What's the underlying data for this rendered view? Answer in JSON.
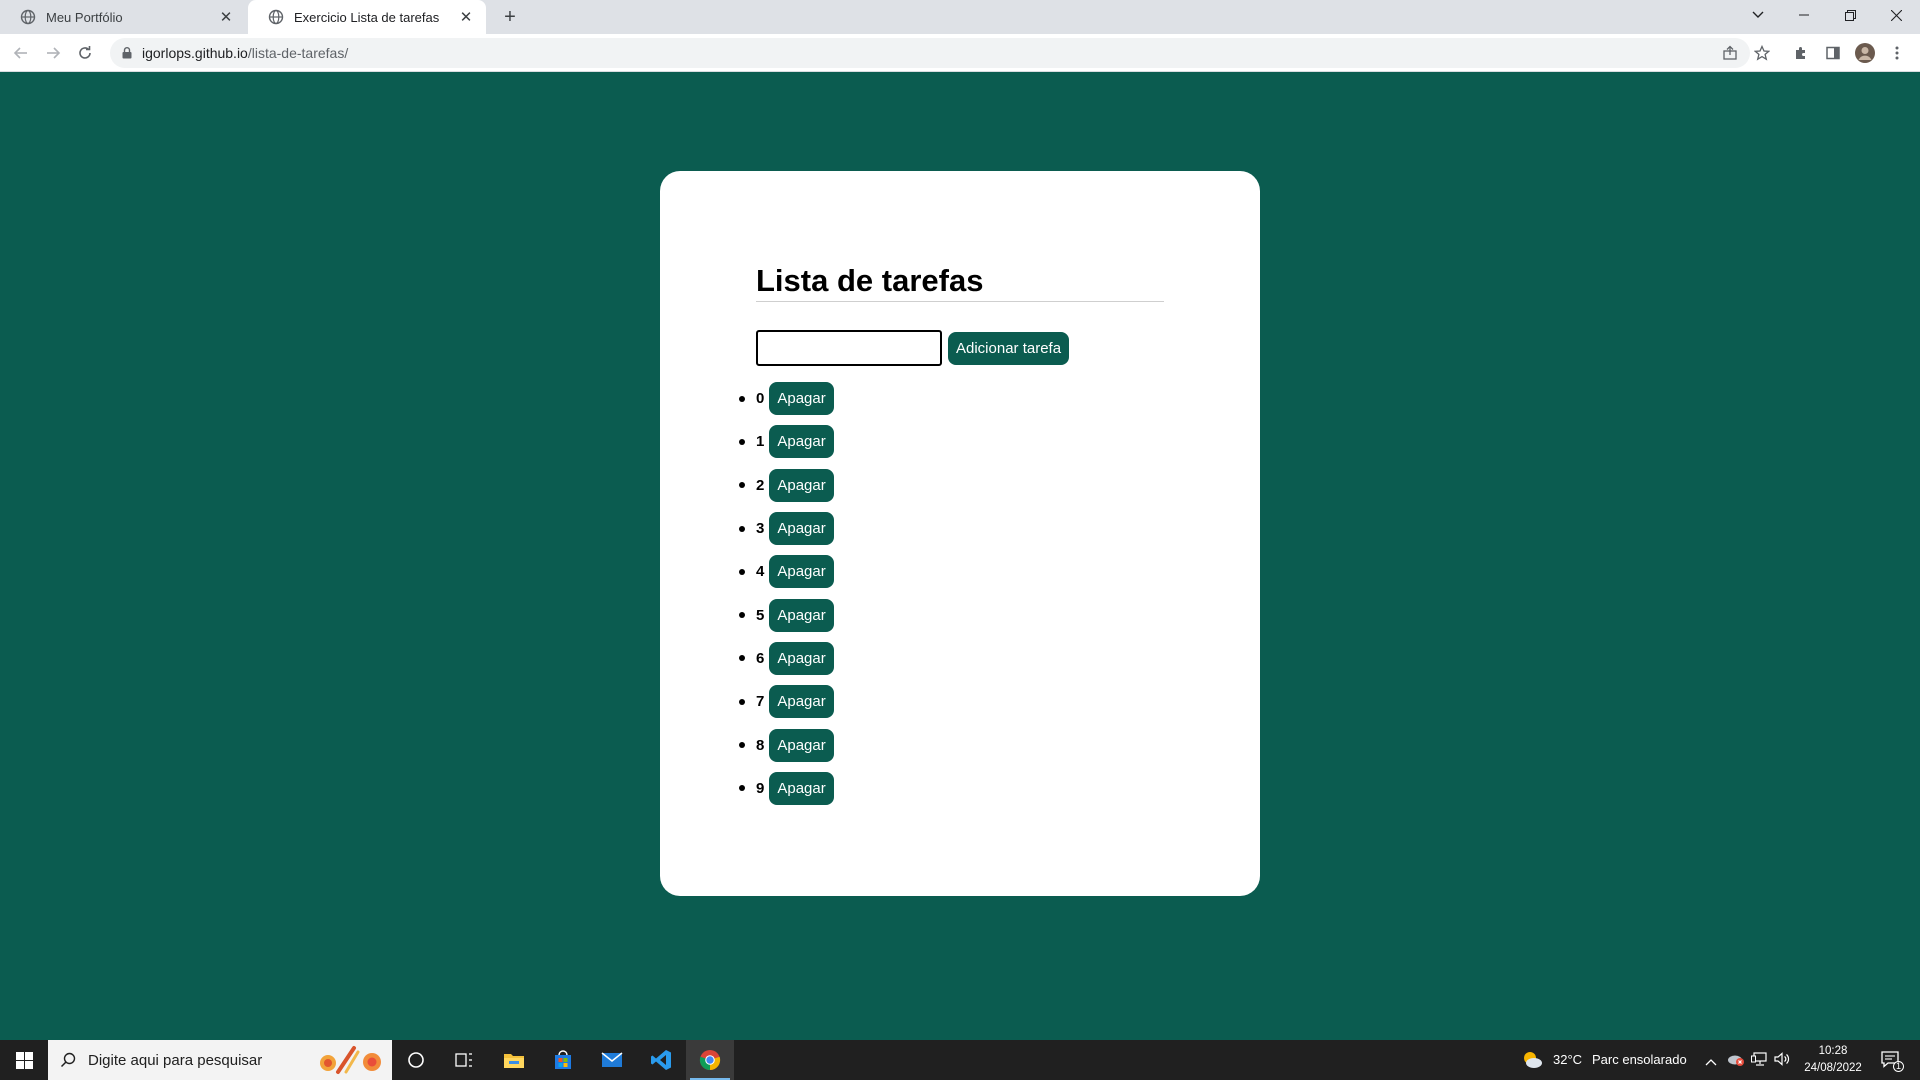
{
  "browser": {
    "tabs": [
      {
        "title": "Meu Portfólio",
        "active": false
      },
      {
        "title": "Exercicio Lista de tarefas",
        "active": true
      }
    ],
    "url_host": "igorlops.github.io",
    "url_path": "/lista-de-tarefas/"
  },
  "page": {
    "title": "Lista de tarefas",
    "input_value": "",
    "add_button_label": "Adicionar tarefa",
    "delete_button_label": "Apagar",
    "tasks": [
      "0",
      "1",
      "2",
      "3",
      "4",
      "5",
      "6",
      "7",
      "8",
      "9"
    ],
    "accent_color": "#0b5c50"
  },
  "taskbar": {
    "search_placeholder": "Digite aqui para pesquisar",
    "temperature": "32°C",
    "weather": "Parc ensolarado",
    "time": "10:28",
    "date": "24/08/2022",
    "notification_count": "1"
  }
}
